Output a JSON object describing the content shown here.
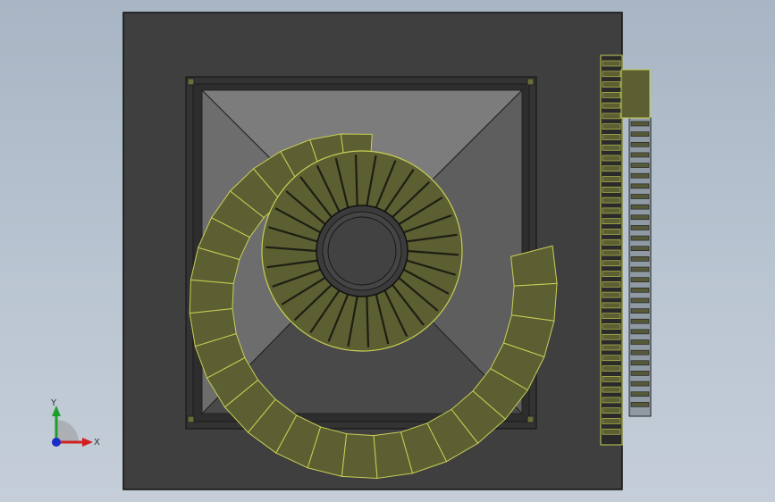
{
  "view": {
    "background_top": "#a7b5c4",
    "background_bottom": "#c5ced8",
    "housing_color": "#3f3f3f",
    "hopper_light": "#7a7a7a",
    "hopper_dark": "#4a4a4a",
    "stair_color": "#5c5f31",
    "stair_edge": "#c8cf56",
    "core_color": "#3a3a3a"
  },
  "model": {
    "inner_disc_sectors": 30,
    "outer_spiral_steps": 26,
    "right_ladder_rungs": 36,
    "side_ladder_rungs": 28
  },
  "triad": {
    "x_label": "X",
    "y_label": "Y",
    "x_color": "#d22020",
    "y_color": "#1f9d2a",
    "z_color": "#1b2dc7"
  }
}
